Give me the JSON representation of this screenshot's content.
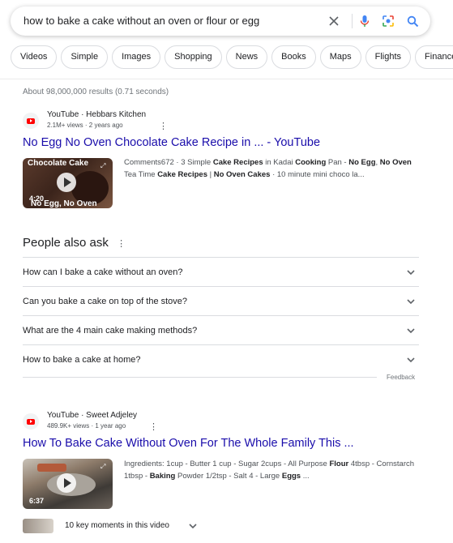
{
  "search": {
    "query": "how to bake a cake without an oven or flour or egg"
  },
  "icons": {
    "clear": "close-icon",
    "voice": "microphone-icon",
    "lens": "lens-icon",
    "search": "search-icon"
  },
  "chips": [
    "Videos",
    "Simple",
    "Images",
    "Shopping",
    "News",
    "Books",
    "Maps",
    "Flights",
    "Finance"
  ],
  "result_stats": "About 98,000,000 results (0.71 seconds)",
  "results": [
    {
      "source": "YouTube · Hebbars Kitchen",
      "meta": "2.1M+ views · 2 years ago",
      "title": "No Egg No Oven Chocolate Cake Recipe in ... - YouTube",
      "duration": "4:20",
      "thumb_top_text": "Chocolate Cake",
      "thumb_bottom_text": "No Egg, No Oven",
      "snippet_parts": [
        {
          "t": "Comments672 · 3 Simple ",
          "b": false
        },
        {
          "t": "Cake Recipes",
          "b": true
        },
        {
          "t": " in Kadai ",
          "b": false
        },
        {
          "t": "Cooking",
          "b": true
        },
        {
          "t": " Pan - ",
          "b": false
        },
        {
          "t": "No Egg",
          "b": true
        },
        {
          "t": ", ",
          "b": false
        },
        {
          "t": "No Oven",
          "b": true
        },
        {
          "t": " Tea Time ",
          "b": false
        },
        {
          "t": "Cake Recipes",
          "b": true
        },
        {
          "t": " | ",
          "b": false
        },
        {
          "t": "No Oven Cakes",
          "b": true
        },
        {
          "t": " · 10 minute mini choco la...",
          "b": false
        }
      ]
    },
    {
      "source": "YouTube · Sweet Adjeley",
      "meta": "489.9K+ views · 1 year ago",
      "title": "How To Bake Cake Without Oven For The Whole Family This ...",
      "duration": "6:37",
      "snippet_parts": [
        {
          "t": "Ingredients: 1cup - Butter 1 cup - Sugar 2cups - All Purpose ",
          "b": false
        },
        {
          "t": "Flour",
          "b": true
        },
        {
          "t": " 4tbsp - Cornstarch 1tbsp - ",
          "b": false
        },
        {
          "t": "Baking",
          "b": true
        },
        {
          "t": " Powder 1/2tsp - Salt 4 - Large ",
          "b": false
        },
        {
          "t": "Eggs",
          "b": true
        },
        {
          "t": " ...",
          "b": false
        }
      ],
      "key_moments": "10 key moments in this video"
    }
  ],
  "people_also_ask": {
    "title": "People also ask",
    "questions": [
      "How can I bake a cake without an oven?",
      "Can you bake a cake on top of the stove?",
      "What are the 4 main cake making methods?",
      "How to bake a cake at home?"
    ],
    "feedback": "Feedback"
  }
}
